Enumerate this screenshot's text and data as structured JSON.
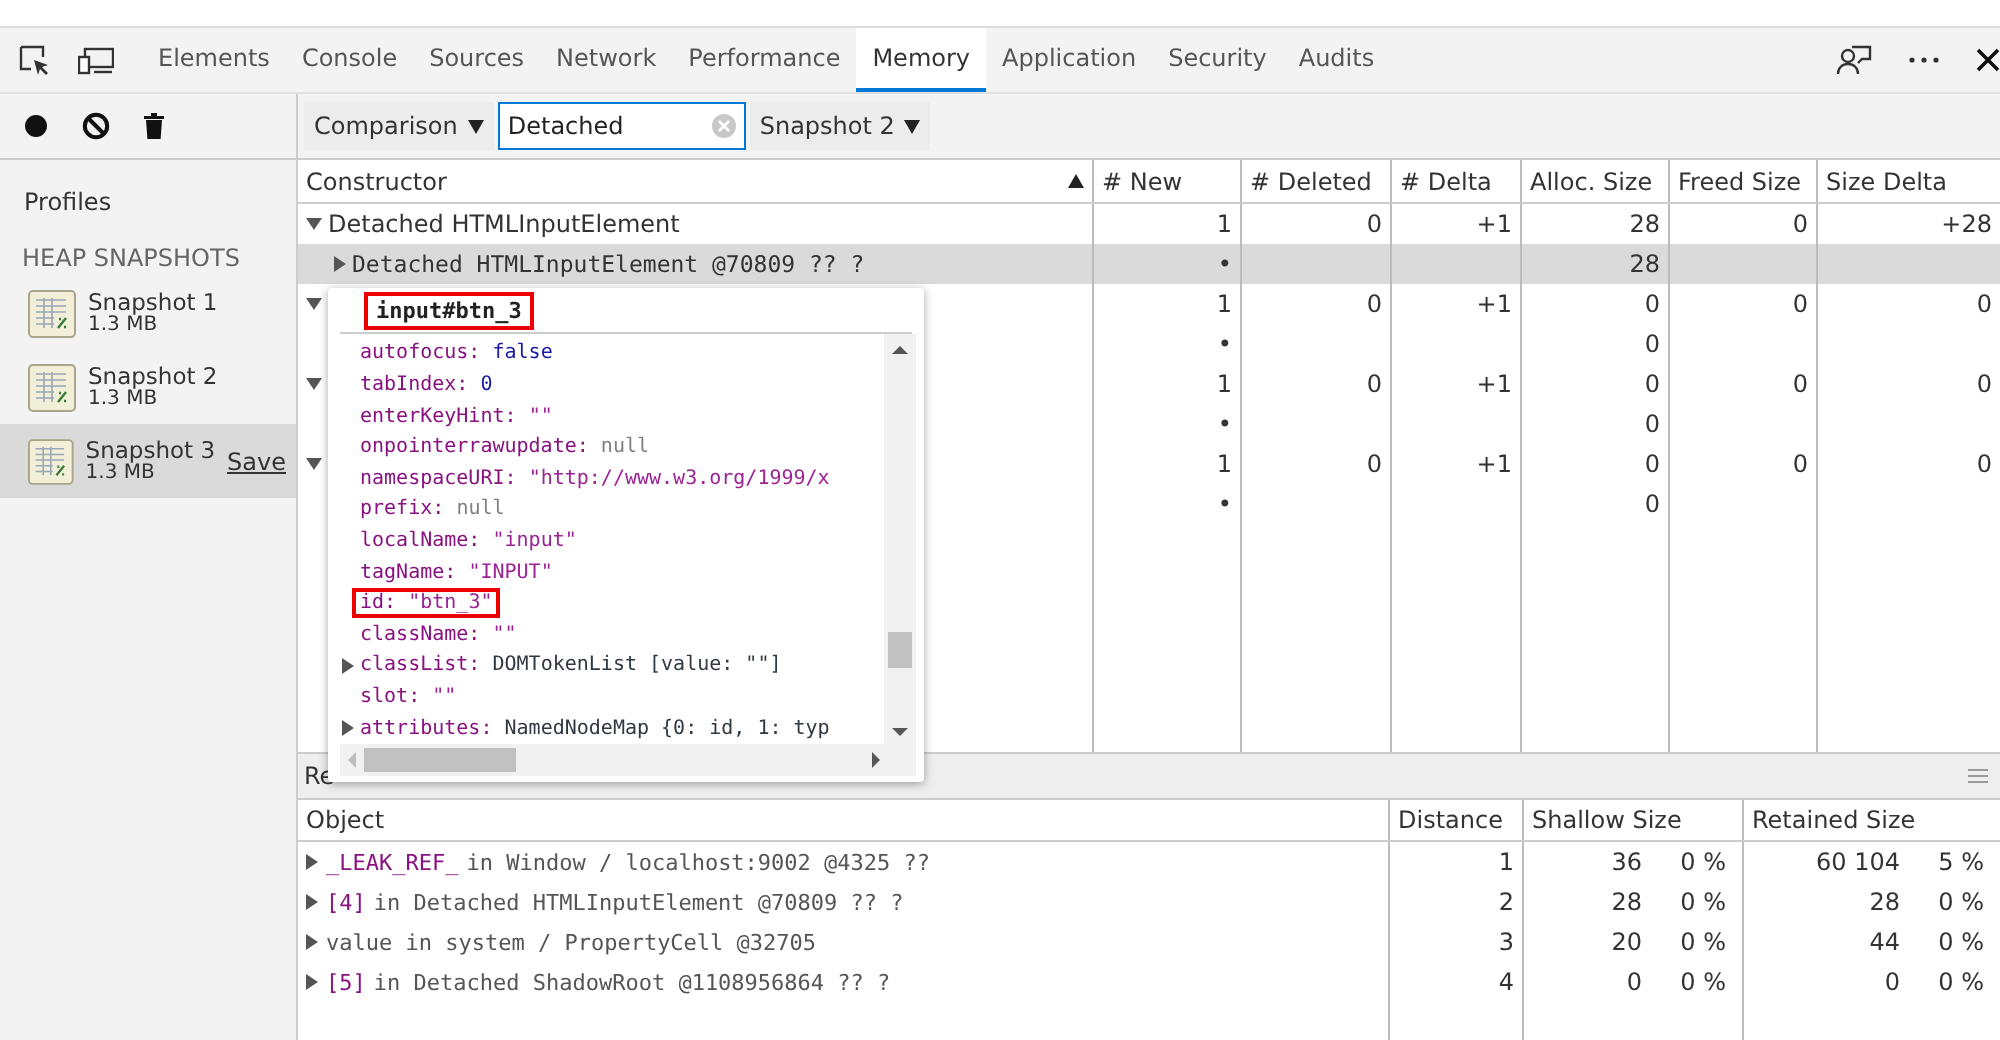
{
  "tabs": [
    {
      "label": "Elements",
      "selected": false
    },
    {
      "label": "Console",
      "selected": false
    },
    {
      "label": "Sources",
      "selected": false
    },
    {
      "label": "Network",
      "selected": false
    },
    {
      "label": "Performance",
      "selected": false
    },
    {
      "label": "Memory",
      "selected": true
    },
    {
      "label": "Application",
      "selected": false
    },
    {
      "label": "Security",
      "selected": false
    },
    {
      "label": "Audits",
      "selected": false
    }
  ],
  "toolbar": {
    "mode": "Comparison",
    "filter": {
      "value": "Detached"
    },
    "baseline": "Snapshot 2"
  },
  "sidebar": {
    "title": "Profiles",
    "section": "HEAP SNAPSHOTS",
    "snapshots": [
      {
        "name": "Snapshot 1",
        "size": "1.3 MB",
        "selected": false
      },
      {
        "name": "Snapshot 2",
        "size": "1.3 MB",
        "selected": false
      },
      {
        "name": "Snapshot 3",
        "size": "1.3 MB",
        "selected": true,
        "action": "Save"
      }
    ]
  },
  "constructor_table": {
    "columns": [
      "Constructor",
      "# New",
      "# Deleted",
      "# Delta",
      "Alloc. Size",
      "Freed Size",
      "Size Delta"
    ],
    "rows": [
      {
        "name": "Detached HTMLInputElement",
        "expanded": true,
        "selected": false,
        "new": "1",
        "deleted": "0",
        "delta": "+1",
        "alloc_size": "28",
        "freed_size": "0",
        "size_delta": "+28",
        "children": [
          {
            "name": "Detached HTMLInputElement @70809 ?? ?",
            "selected": true,
            "new": "•",
            "alloc_size": "28"
          }
        ]
      },
      {
        "expanded": true,
        "selected": false,
        "new": "1",
        "deleted": "0",
        "delta": "+1",
        "alloc_size": "0",
        "freed_size": "0",
        "size_delta": "0",
        "children": [
          {
            "selected": false,
            "new": "•",
            "alloc_size": "0"
          }
        ]
      },
      {
        "expanded": true,
        "selected": false,
        "new": "1",
        "deleted": "0",
        "delta": "+1",
        "alloc_size": "0",
        "freed_size": "0",
        "size_delta": "0",
        "children": [
          {
            "selected": false,
            "new": "•",
            "alloc_size": "0"
          }
        ]
      },
      {
        "expanded": true,
        "selected": false,
        "new": "1",
        "deleted": "0",
        "delta": "+1",
        "alloc_size": "0",
        "freed_size": "0",
        "size_delta": "0",
        "children": [
          {
            "selected": false,
            "new": "•",
            "alloc_size": "0"
          }
        ]
      }
    ]
  },
  "popover": {
    "title": "input#btn_3",
    "title_highlighted": true,
    "properties": [
      {
        "key": "autofocus:",
        "value": "false",
        "kind": "boolean",
        "expandable": false,
        "highlighted": false
      },
      {
        "key": "tabIndex:",
        "value": "0",
        "kind": "number",
        "expandable": false,
        "highlighted": false
      },
      {
        "key": "enterKeyHint:",
        "value": "\"\"",
        "kind": "string",
        "expandable": false,
        "highlighted": false
      },
      {
        "key": "onpointerrawupdate:",
        "value": "null",
        "kind": "null",
        "expandable": false,
        "highlighted": false
      },
      {
        "key": "namespaceURI:",
        "value": "\"http://www.w3.org/1999/x",
        "kind": "string",
        "expandable": false,
        "highlighted": false
      },
      {
        "key": "prefix:",
        "value": "null",
        "kind": "null",
        "expandable": false,
        "highlighted": false
      },
      {
        "key": "localName:",
        "value": "\"input\"",
        "kind": "string",
        "expandable": false,
        "highlighted": false
      },
      {
        "key": "tagName:",
        "value": "\"INPUT\"",
        "kind": "string",
        "expandable": false,
        "highlighted": false
      },
      {
        "key": "id:",
        "value": "\"btn_3\"",
        "kind": "string",
        "expandable": false,
        "highlighted": true
      },
      {
        "key": "className:",
        "value": "\"\"",
        "kind": "string",
        "expandable": false,
        "highlighted": false
      },
      {
        "key": "classList:",
        "value": "DOMTokenList [value: \"\"]",
        "kind": "object",
        "expandable": true,
        "highlighted": false
      },
      {
        "key": "slot:",
        "value": "\"\"",
        "kind": "string",
        "expandable": false,
        "highlighted": false
      },
      {
        "key": "attributes:",
        "value": "NamedNodeMap {0: id, 1: typ",
        "kind": "object",
        "expandable": true,
        "highlighted": false
      }
    ]
  },
  "retainers": {
    "label": "Re",
    "columns": [
      "Object",
      "Distance",
      "Shallow Size",
      "Retained Size"
    ],
    "rows": [
      {
        "name": "_LEAK_REF_",
        "text": "in Window / localhost:9002 @4325 ??",
        "expanded": false,
        "distance": "1",
        "shallow": "36",
        "shallow_pct": "0 %",
        "retained": "60 104",
        "retained_pct": "5 %"
      },
      {
        "name": "[4]",
        "text": "in Detached HTMLInputElement @70809 ?? ?",
        "expanded": false,
        "distance": "2",
        "shallow": "28",
        "shallow_pct": "0 %",
        "retained": "28",
        "retained_pct": "0 %"
      },
      {
        "text": "value in system / PropertyCell @32705",
        "expanded": false,
        "distance": "3",
        "shallow": "20",
        "shallow_pct": "0 %",
        "retained": "44",
        "retained_pct": "0 %"
      },
      {
        "name": "[5]",
        "text": "in Detached ShadowRoot @1108956864 ?? ?",
        "expanded": false,
        "distance": "4",
        "shallow": "0",
        "shallow_pct": "0 %",
        "retained": "0",
        "retained_pct": "0 %"
      }
    ]
  }
}
